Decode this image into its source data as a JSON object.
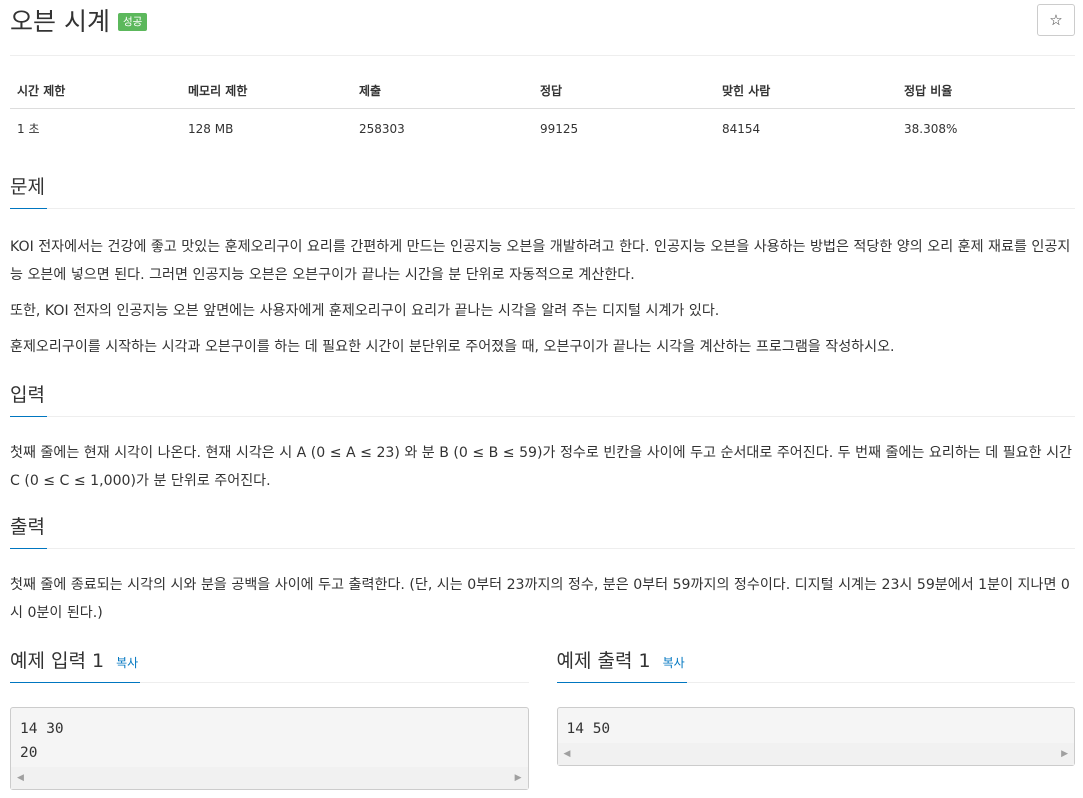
{
  "header": {
    "title": "오븐 시계",
    "badge": "성공",
    "star_label": "☆"
  },
  "stats": {
    "headers": [
      "시간 제한",
      "메모리 제한",
      "제출",
      "정답",
      "맞힌 사람",
      "정답 비율"
    ],
    "values": [
      "1 초",
      "128 MB",
      "258303",
      "99125",
      "84154",
      "38.308%"
    ]
  },
  "problem": {
    "title": "문제",
    "paragraphs": [
      "KOI 전자에서는 건강에 좋고 맛있는 훈제오리구이 요리를 간편하게 만드는 인공지능 오븐을 개발하려고 한다. 인공지능 오븐을 사용하는 방법은 적당한 양의 오리 훈제 재료를 인공지능 오븐에 넣으면 된다. 그러면 인공지능 오븐은 오븐구이가 끝나는 시간을 분 단위로 자동적으로 계산한다.",
      "또한, KOI 전자의 인공지능 오븐 앞면에는 사용자에게 훈제오리구이 요리가 끝나는 시각을 알려 주는 디지털 시계가 있다.",
      "훈제오리구이를 시작하는 시각과 오븐구이를 하는 데 필요한 시간이 분단위로 주어졌을 때, 오븐구이가 끝나는 시각을 계산하는 프로그램을 작성하시오."
    ]
  },
  "input": {
    "title": "입력",
    "text": "첫째 줄에는 현재 시각이 나온다. 현재 시각은 시 A (0 ≤ A ≤ 23) 와 분 B (0 ≤ B ≤ 59)가 정수로 빈칸을 사이에 두고 순서대로 주어진다. 두 번째 줄에는 요리하는 데 필요한 시간 C (0 ≤ C ≤ 1,000)가 분 단위로 주어진다."
  },
  "output": {
    "title": "출력",
    "text": "첫째 줄에 종료되는 시각의 시와 분을 공백을 사이에 두고 출력한다. (단, 시는 0부터 23까지의 정수, 분은 0부터 59까지의 정수이다. 디지털 시계는 23시 59분에서 1분이 지나면 0시 0분이 된다.)"
  },
  "examples": {
    "input_title": "예제 입력 1",
    "input_copy": "복사",
    "input_text": "14 30\n20",
    "output_title": "예제 출력 1",
    "output_copy": "복사",
    "output_text": "14 50"
  },
  "colors": {
    "badge_success": "#5cb85c",
    "accent_link": "#0076c0"
  }
}
